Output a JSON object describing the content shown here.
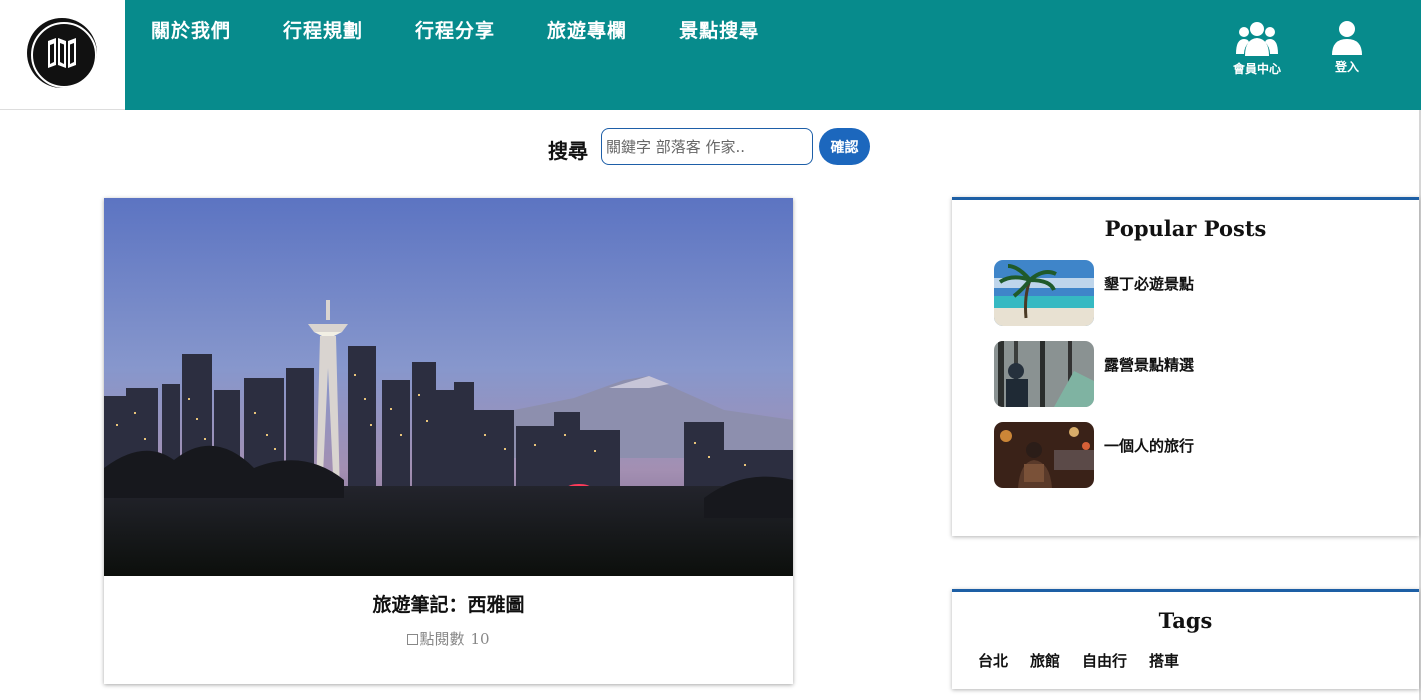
{
  "nav": {
    "items": [
      {
        "label": "關於我們"
      },
      {
        "label": "行程規劃"
      },
      {
        "label": "行程分享"
      },
      {
        "label": "旅遊專欄"
      },
      {
        "label": "景點搜尋"
      }
    ]
  },
  "user": {
    "members_label": "會員中心",
    "login_label": "登入"
  },
  "search": {
    "label": "搜尋",
    "placeholder": "關鍵字 部落客 作家..",
    "button": "確認"
  },
  "post": {
    "title": "旅遊筆記：西雅圖",
    "views_label": "點閱數",
    "views": "10"
  },
  "popular": {
    "title": "Popular Posts",
    "items": [
      {
        "label": "墾丁必遊景點"
      },
      {
        "label": "露營景點精選"
      },
      {
        "label": "一個人的旅行"
      }
    ]
  },
  "tags": {
    "title": "Tags",
    "items": [
      "台北",
      "旅館",
      "自由行",
      "搭車"
    ]
  },
  "colors": {
    "header": "#078b8c",
    "accent_blue": "#1c67bd",
    "widget_border": "#1d5fa5"
  },
  "icons": {
    "logo": "folded-map-icon",
    "members": "users-icon",
    "login": "user-icon"
  }
}
